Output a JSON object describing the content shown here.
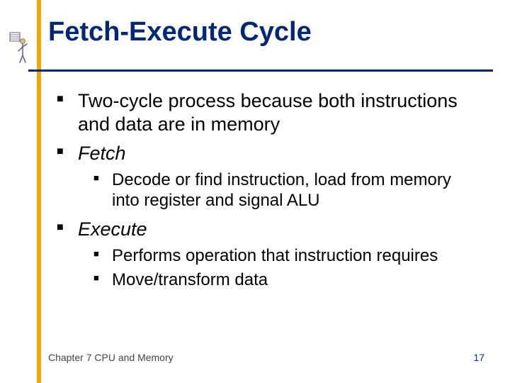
{
  "title": "Fetch-Execute Cycle",
  "bullets": {
    "b1": "Two-cycle process because both instructions and data are in memory",
    "b2": "Fetch",
    "b2_sub1": "Decode or find instruction, load from memory into register and signal ALU",
    "b3": "Execute",
    "b3_sub1": "Performs operation that instruction requires",
    "b3_sub2": "Move/transform data"
  },
  "footer": {
    "chapter": "Chapter 7 CPU and Memory",
    "page": "17"
  },
  "icons": {
    "deco": "presenter-figure-icon"
  }
}
